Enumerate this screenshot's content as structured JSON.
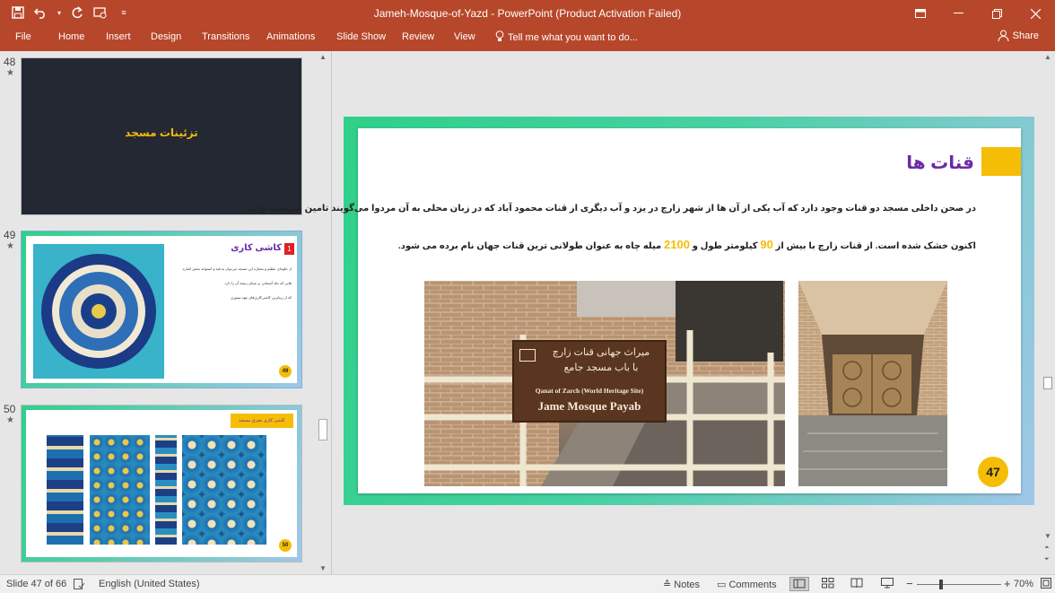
{
  "titlebar": {
    "title": "Jameh-Mosque-of-Yazd  -  PowerPoint (Product Activation Failed)",
    "qat_icons": [
      "save-icon",
      "undo-icon",
      "redo-icon",
      "start-from-beginning-icon",
      "customize-qat-icon"
    ],
    "win_icons": [
      "ribbon-display-icon",
      "minimize-icon",
      "maximize-icon",
      "close-icon"
    ]
  },
  "ribbon": {
    "tabs": [
      "File",
      "Home",
      "Insert",
      "Design",
      "Transitions",
      "Animations",
      "Slide Show",
      "Review",
      "View"
    ],
    "tell_me": "Tell me what you want to do...",
    "share": "Share"
  },
  "thumbnails": [
    {
      "number": "48",
      "star": "★",
      "title": "تزئینات مسجد"
    },
    {
      "number": "49",
      "star": "★",
      "title": "کاشی کاری",
      "badge": "1",
      "lines": [
        "از جلوه‌ای عظیم و ممتازه این مسجد می‌توان به قبه و استوانه بخش اشاره",
        "هایی که جلد آسمانی بر مبنای زمینه آن را دارد",
        "که از زیباترین کاشی‌کاری‌های عهد تیموری"
      ],
      "page": "49"
    },
    {
      "number": "50",
      "star": "★",
      "title": "کاشی کاری معرق مسجد",
      "page": "50"
    }
  ],
  "slide": {
    "title": "قنات ها",
    "line1": "در صحن داخلی مسجد دو قنات وجود دارد که آب یکی از آن ها از شهر زارچ در یزد و آب دیگری از قنات محمود آباد که در زبان محلی به آن مردوا می‌گویند تامین می‌شده ولی",
    "line2_a": "اکنون خشک شده است. از قنات زارچ با بیش از",
    "line2_num1": "90",
    "line2_b": "کیلومتر طول و",
    "line2_num2": "2100",
    "line2_c": "میله چاه به عنوان طولانی ترین قنات جهان نام برده می شود.",
    "sign_line1": "میراث جهانی قنات زارچ",
    "sign_line2": "با باب مسجد جامع",
    "sign_line3": "Qanat of Zarch (World Heritage Site)",
    "sign_line4": "Jame Mosque Payab",
    "page_number": "47"
  },
  "status": {
    "slide_info": "Slide 47 of 66",
    "language": "English (United States)",
    "notes": "Notes",
    "comments": "Comments",
    "zoom": "70%",
    "zoom_minus": "−",
    "zoom_plus": "+"
  },
  "colors": {
    "accent": "#b7472a",
    "yellow": "#f5bd06",
    "purple": "#6b2aa6"
  }
}
